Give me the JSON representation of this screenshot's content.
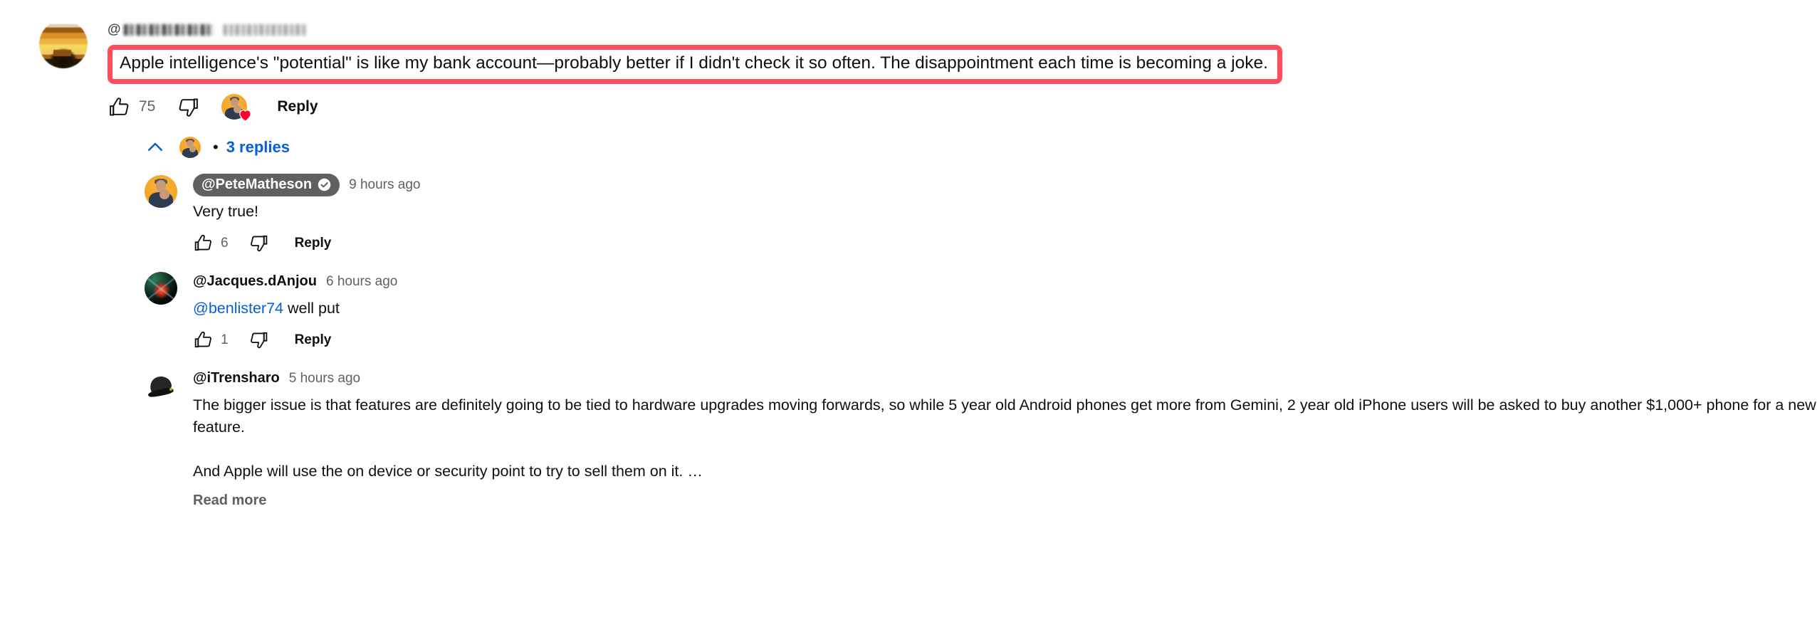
{
  "colors": {
    "highlight_border": "#ff4d5e",
    "link_blue": "#065fd4",
    "secondary_text": "#606060",
    "primary_text": "#0f0f0f",
    "owner_chip_bg": "#606060",
    "heart_red": "#ff0033"
  },
  "top_comment": {
    "author_name_redacted": true,
    "author_handle_prefix": "@",
    "timestamp_redacted": true,
    "text": "Apple intelligence's \"potential\" is like my bank account—probably better if I didn't check it so often. The disappointment each time is becoming a joke.",
    "like_count": "75",
    "dislike_count": "",
    "reply_label": "Reply",
    "creator_heart": true
  },
  "replies_toggle": {
    "separator": "•",
    "label": "3 replies",
    "expanded": true
  },
  "replies": [
    {
      "author": "@PeteMatheson",
      "is_channel_owner": true,
      "verified": true,
      "timestamp": "9 hours ago",
      "text": "Very true!",
      "like_count": "6",
      "reply_label": "Reply",
      "avatar_kind": "owner"
    },
    {
      "author": "@Jacques.dAnjou",
      "is_channel_owner": false,
      "verified": false,
      "timestamp": "6 hours ago",
      "mention": "@benlister74",
      "text": " well put",
      "like_count": "1",
      "reply_label": "Reply",
      "avatar_kind": "cosmic"
    },
    {
      "author": "@iTrensharo",
      "is_channel_owner": false,
      "verified": false,
      "timestamp": "5 hours ago",
      "paragraph_1": "The bigger issue is that features are definitely going to be tied to hardware upgrades moving forwards, so while 5 year old Android phones get more from Gemini, 2 year old iPhone users will be asked to buy another $1,000+ phone for a new feature.",
      "paragraph_2": "And Apple will use the on device or security point to try to sell them on it. …",
      "read_more_label": "Read more",
      "avatar_kind": "boot"
    }
  ],
  "icons": {
    "thumb_up": "thumbs-up-icon",
    "thumb_down": "thumbs-down-icon",
    "heart": "heart-icon",
    "chevron_up": "chevron-up-icon",
    "verified_check": "verified-badge-icon"
  }
}
